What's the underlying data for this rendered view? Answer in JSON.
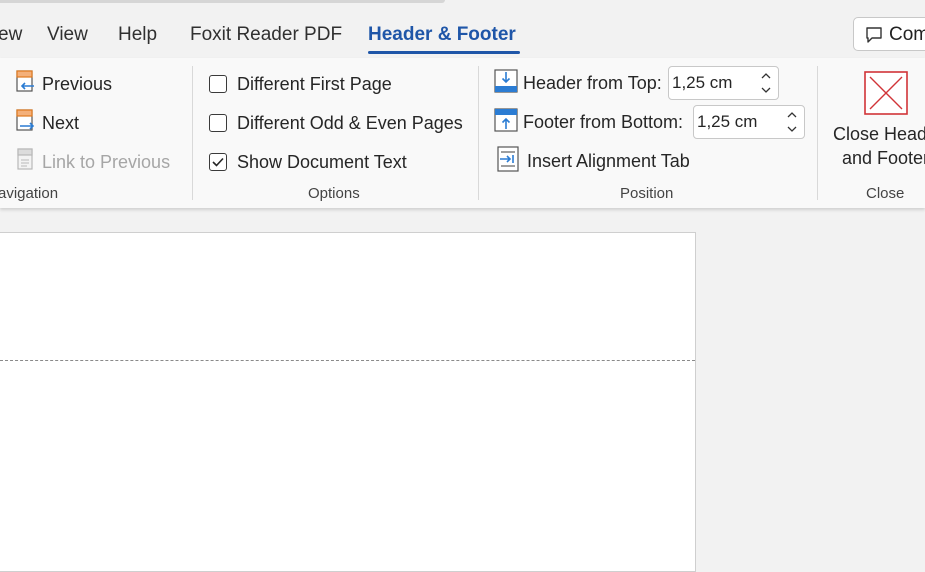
{
  "tabs": [
    {
      "label": "ew",
      "active": false
    },
    {
      "label": "View",
      "active": false
    },
    {
      "label": "Help",
      "active": false
    },
    {
      "label": "Foxit Reader PDF",
      "active": false
    },
    {
      "label": "Header & Footer",
      "active": true
    }
  ],
  "comments_button": {
    "label": "Com",
    "icon": "comment-icon"
  },
  "navigation": {
    "group_label": "avigation",
    "previous": {
      "label": "Previous",
      "icon": "previous-section-icon"
    },
    "next": {
      "label": "Next",
      "icon": "next-section-icon"
    },
    "link": {
      "label": "Link to Previous",
      "icon": "link-to-previous-icon",
      "disabled": true
    }
  },
  "options": {
    "group_label": "Options",
    "items": [
      {
        "label": "Different First Page",
        "checked": false
      },
      {
        "label": "Different Odd & Even Pages",
        "checked": false
      },
      {
        "label": "Show Document Text",
        "checked": true
      }
    ]
  },
  "position": {
    "group_label": "Position",
    "header_from_top": {
      "label": "Header from Top:",
      "value": "1,25 cm",
      "icon": "header-from-top-icon"
    },
    "footer_from_bottom": {
      "label": "Footer from Bottom:",
      "value": "1,25 cm",
      "icon": "footer-from-bottom-icon"
    },
    "insert_tab": {
      "label": "Insert Alignment Tab",
      "icon": "insert-alignment-tab-icon"
    }
  },
  "close": {
    "group_label": "Close",
    "line1": "Close Heade",
    "line2": "and Footer",
    "icon": "close-x-icon",
    "accent": "#d13438"
  },
  "colors": {
    "accent": "#1f56a8",
    "icon_blue": "#2b7cd3",
    "icon_orange": "#e07a1f"
  }
}
